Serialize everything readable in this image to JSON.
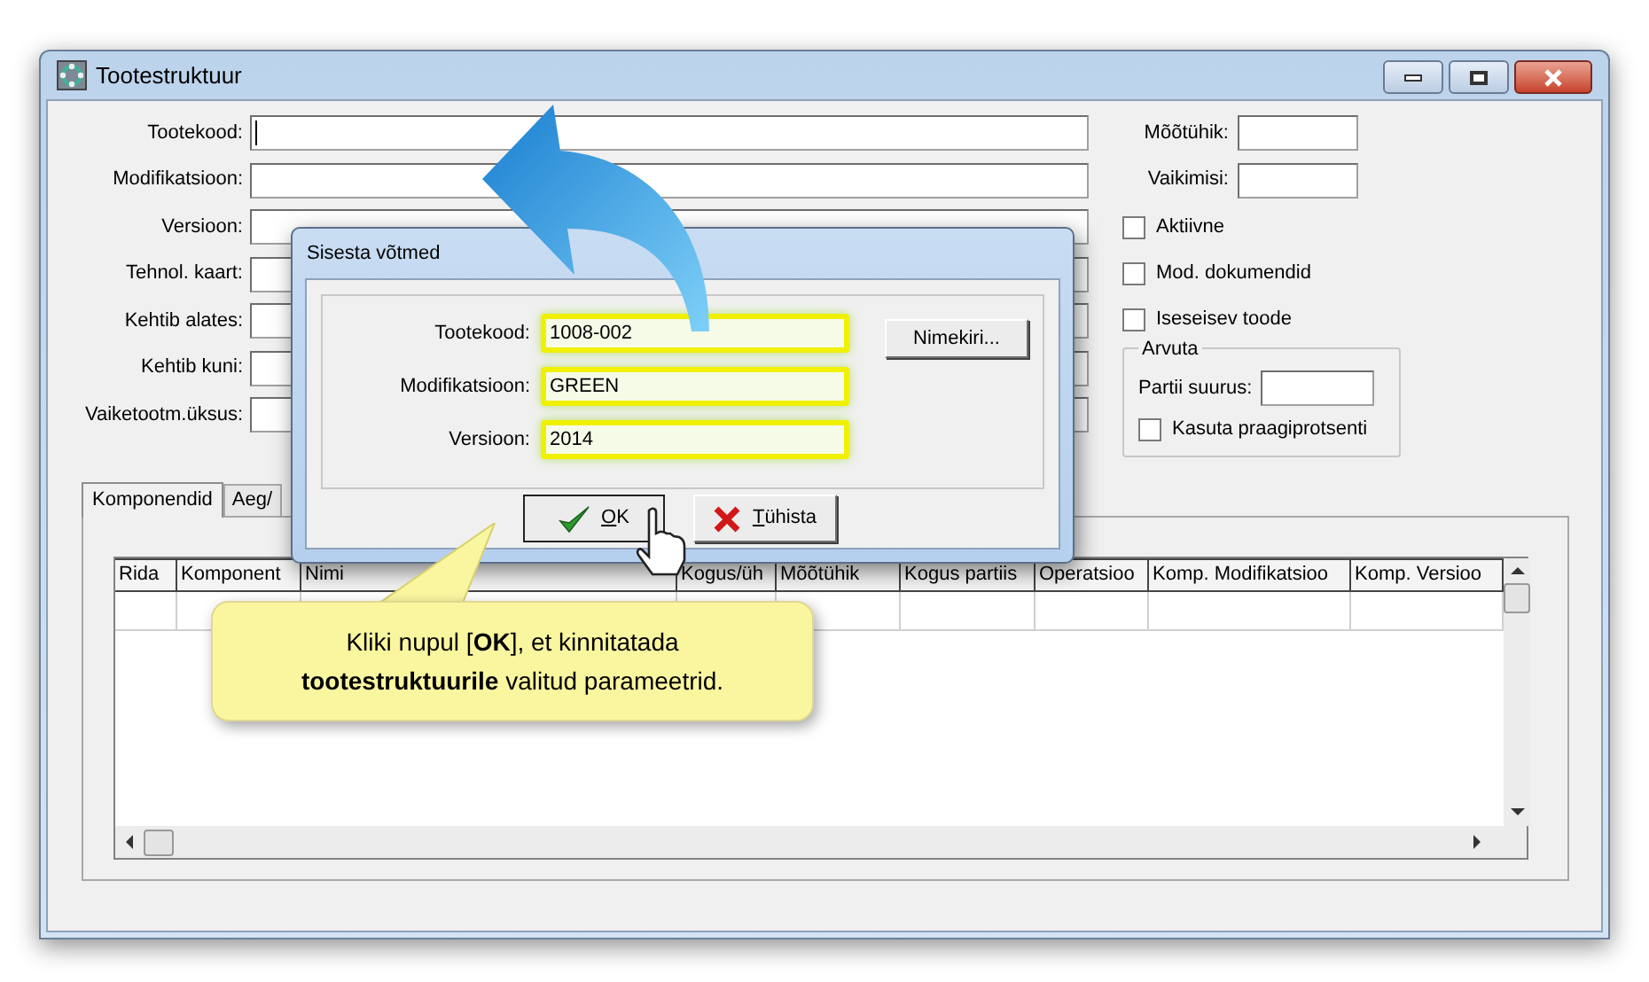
{
  "window": {
    "title": "Tootestruktuur"
  },
  "form": {
    "fields": [
      {
        "label": "Tootekood:",
        "focused": true
      },
      {
        "label": "Modifikatsioon:",
        "focused": false
      },
      {
        "label": "Versioon:",
        "focused": false
      },
      {
        "label": "Tehnol. kaart:",
        "focused": false
      },
      {
        "label": "Kehtib alates:",
        "focused": false
      },
      {
        "label": "Kehtib kuni:",
        "focused": false
      },
      {
        "label": "Vaiketootm.üksus:",
        "focused": false
      }
    ],
    "side_fields": [
      {
        "label": "Mõõtühik:"
      },
      {
        "label": "Vaikimisi:"
      }
    ],
    "checkboxes": [
      {
        "label": "Aktiivne",
        "checked": false
      },
      {
        "label": "Mod. dokumendid",
        "checked": false
      },
      {
        "label": "Iseseisev toode",
        "checked": false
      }
    ],
    "arvuta": {
      "title": "Arvuta",
      "field_label": "Partii suurus:",
      "checkbox": {
        "label": "Kasuta praagiprotsenti",
        "checked": false
      }
    }
  },
  "tabs": [
    {
      "label": "Komponendid",
      "selected": true
    },
    {
      "label": "Aeg/",
      "selected": false
    }
  ],
  "table": {
    "columns": [
      "Rida",
      "Komponent",
      "Nimi",
      "Kogus/üh",
      "Mõõtühik",
      "Kogus partiis",
      "Operatsioo",
      "Komp. Modifikatsioo",
      "Komp. Versioo"
    ]
  },
  "dialog": {
    "title": "Sisesta võtmed",
    "fields": [
      {
        "label": "Tootekood:",
        "value": "1008-002",
        "highlighted": true
      },
      {
        "label": "Modifikatsioon:",
        "value": "GREEN",
        "highlighted": true
      },
      {
        "label": "Versioon:",
        "value": "2014",
        "highlighted": true
      }
    ],
    "list_button": "Nimekiri...",
    "buttons": [
      {
        "label": "OK",
        "kind": "ok"
      },
      {
        "label": "Tühista",
        "kind": "cancel"
      }
    ]
  },
  "callout": {
    "text": "Kliki nupul [**OK**], et kinnitatada **tootestruktuurile** valitud parameetrid."
  }
}
